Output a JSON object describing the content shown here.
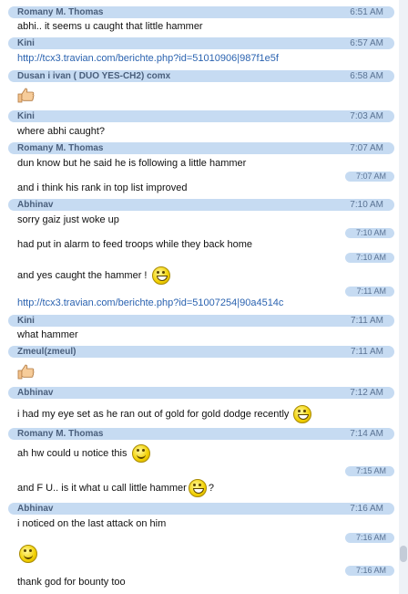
{
  "messages": [
    {
      "sender": "Romany M. Thomas",
      "time": "6:51 AM",
      "text": "abhi.. it seems u caught that little hammer"
    },
    {
      "sender": "Kini",
      "time": "6:57 AM",
      "link": "http://tcx3.travian.com/berichte.php?id=51010906|987f1e5f"
    },
    {
      "sender": "Dusan i ivan ( DUO YES-CH2) comx",
      "time": "6:58 AM",
      "icon": "thumbs-up-icon"
    },
    {
      "sender": "Kini",
      "time": "7:03 AM",
      "text": "where abhi caught?"
    },
    {
      "sender": "Romany M. Thomas",
      "time": "7:07 AM",
      "text": "dun know but he said he is following a little hammer"
    },
    {
      "time": "7:07 AM",
      "text": "and i think his rank in top list improved"
    },
    {
      "sender": "Abhinav",
      "time": "7:10 AM",
      "text": "sorry gaiz just woke up"
    },
    {
      "time": "7:10 AM",
      "text": "had put in alarm to feed troops while they back home"
    },
    {
      "time": "7:10 AM",
      "text": "and yes caught the hammer !"
    },
    {
      "time": "7:11 AM",
      "link": "http://tcx3.travian.com/berichte.php?id=51007254|90a4514c"
    },
    {
      "sender": "Kini",
      "time": "7:11 AM",
      "text": "what hammer"
    },
    {
      "sender": "Zmeul(zmeul)",
      "time": "7:11 AM",
      "icon": "thumbs-up-icon"
    },
    {
      "sender": "Abhinav",
      "time": "7:12 AM",
      "text": "i had my eye set as he ran out of gold for gold dodge recently"
    },
    {
      "sender": "Romany M. Thomas",
      "time": "7:14 AM",
      "text": "ah hw could u notice this"
    },
    {
      "time": "7:15 AM",
      "text": "and F U.. is it what u call little hammer",
      "after_icon": "?"
    },
    {
      "sender": "Abhinav",
      "time": "7:16 AM",
      "text": "i noticed on the last attack on him"
    },
    {
      "time": "7:16 AM",
      "icon": "smile-icon"
    },
    {
      "time": "7:16 AM",
      "text": "thank god for bounty too"
    }
  ]
}
